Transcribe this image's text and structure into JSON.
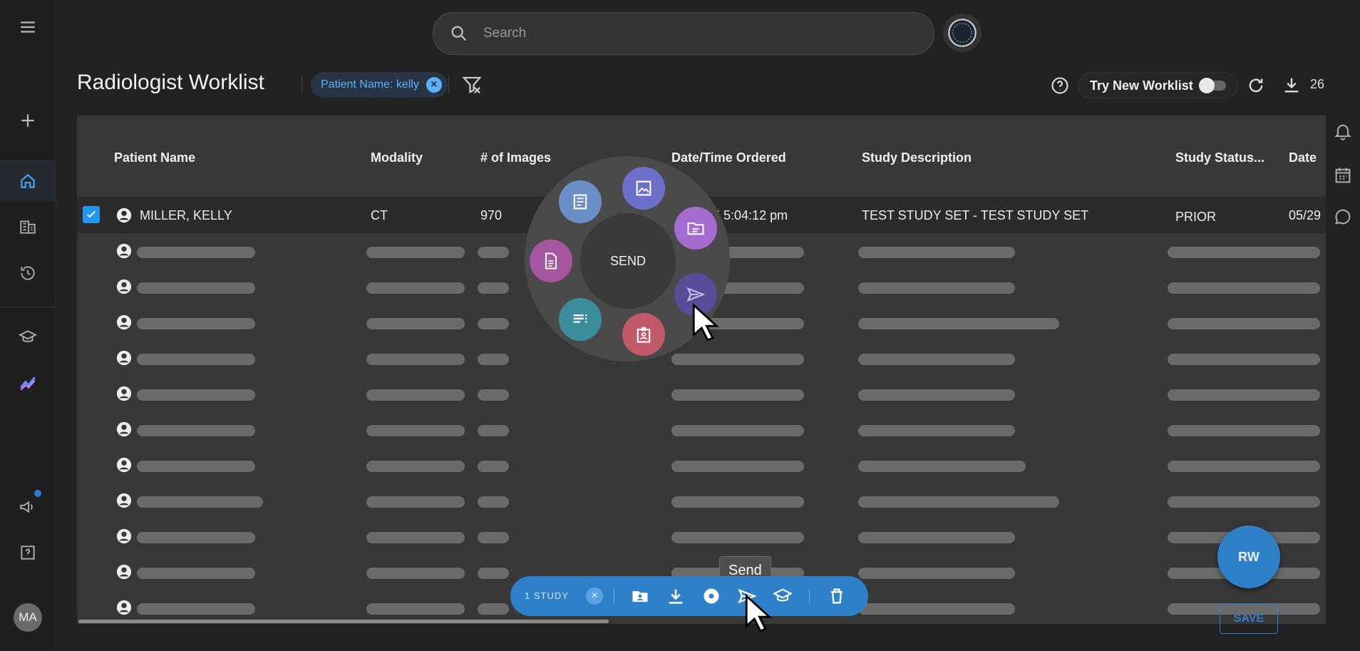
{
  "search": {
    "placeholder": "Search"
  },
  "header": {
    "title": "Radiologist Worklist",
    "filter_chip": "Patient Name: kelly",
    "try_new_label": "Try New Worklist",
    "download_count": "26"
  },
  "table": {
    "columns": [
      "Patient Name",
      "Modality",
      "# of Images",
      "Date/Time Ordered",
      "Study Description",
      "Study Status...",
      "Date"
    ],
    "selected_row": {
      "patient_name": "MILLER, KELLY",
      "modality": "CT",
      "images": "970",
      "date_ordered": "25 5:04:12 pm",
      "description": "TEST STUDY SET - TEST STUDY SET",
      "status": "PRIOR",
      "date": "05/29"
    }
  },
  "radial_menu": {
    "center_label": "SEND"
  },
  "action_bar": {
    "label": "1 STUDY",
    "tooltip": "Send"
  },
  "fab": {
    "label": "RW",
    "save_label": "SAVE"
  },
  "user": {
    "initials": "MA"
  },
  "colors": {
    "accent": "#2e80c9",
    "chip_text": "#5fb0ff",
    "checkbox": "#2196f3"
  }
}
